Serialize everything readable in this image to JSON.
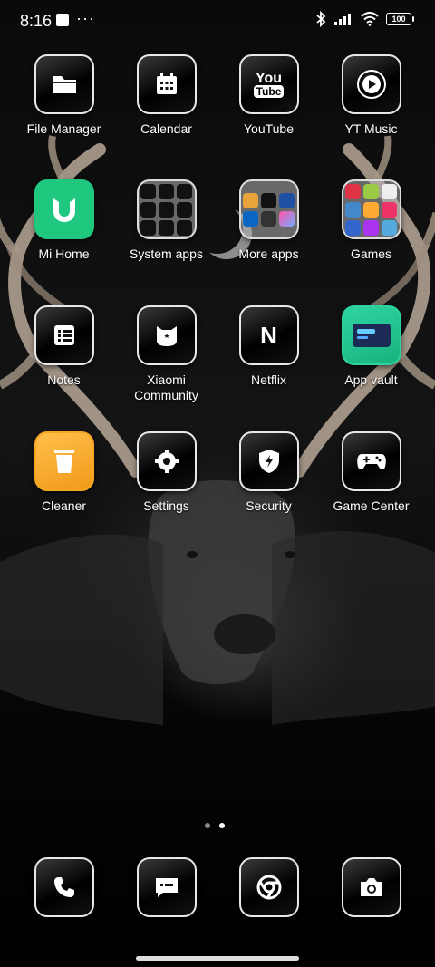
{
  "status_bar": {
    "time": "8:16",
    "overflow": "···",
    "battery": "100"
  },
  "apps": [
    {
      "label": "File Manager",
      "icon": "folder-icon"
    },
    {
      "label": "Calendar",
      "icon": "calendar-icon"
    },
    {
      "label": "YouTube",
      "icon": "youtube-icon"
    },
    {
      "label": "YT Music",
      "icon": "play-circle-icon"
    },
    {
      "label": "Mi Home",
      "icon": "mi-home-icon"
    },
    {
      "label": "System apps",
      "icon": "folder-system-apps"
    },
    {
      "label": "More apps",
      "icon": "folder-more-apps"
    },
    {
      "label": "Games",
      "icon": "folder-games"
    },
    {
      "label": "Notes",
      "icon": "notes-icon"
    },
    {
      "label": "Xiaomi Community",
      "icon": "xiaomi-community-icon"
    },
    {
      "label": "Netflix",
      "icon": "netflix-icon"
    },
    {
      "label": "App vault",
      "icon": "app-vault-icon"
    },
    {
      "label": "Cleaner",
      "icon": "trash-icon"
    },
    {
      "label": "Settings",
      "icon": "gear-icon"
    },
    {
      "label": "Security",
      "icon": "shield-icon"
    },
    {
      "label": "Game Center",
      "icon": "gamepad-icon"
    }
  ],
  "youtube_logo": {
    "line1": "You",
    "line2": "Tube"
  },
  "netflix_letter": "N",
  "dock": [
    {
      "name": "phone",
      "icon": "phone-icon"
    },
    {
      "name": "messages",
      "icon": "message-icon"
    },
    {
      "name": "chrome",
      "icon": "chrome-icon"
    },
    {
      "name": "camera",
      "icon": "camera-icon"
    }
  ],
  "pages": {
    "count": 2,
    "current": 2
  },
  "colors": {
    "mi_home": "#1fc77f",
    "cleaner": "#f5a623",
    "app_vault": "#2ed3a0"
  }
}
